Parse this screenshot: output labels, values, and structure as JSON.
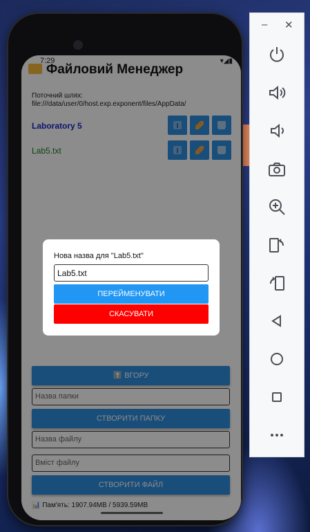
{
  "status_bar": {
    "time": "7:29",
    "right": "▾◢▮"
  },
  "app": {
    "title": "Файловий Менеджер",
    "path": "Поточний шлях: file:///data/user/0/host.exp.exponent/files/AppData/"
  },
  "entries": [
    {
      "name": "Laboratory 5",
      "kind": "folder"
    },
    {
      "name": "Lab5.txt",
      "kind": "file"
    }
  ],
  "buttons": {
    "up": "⬆️ ВГОРУ",
    "create_folder": "СТВОРИТИ ПАПКУ",
    "create_file": "СТВОРИТИ ФАЙЛ"
  },
  "fields": {
    "folder_name_placeholder": "Назва папки",
    "file_name_placeholder": "Назва файлу",
    "file_content_placeholder": "Вміст файлу"
  },
  "memory": "📊 Пам'ять: 1907.94MB / 5939.59MB",
  "dialog": {
    "title": "Нова назва для \"Lab5.txt\"",
    "input_value": "Lab5.txt",
    "rename": "ПЕРЕЙМЕНУВАТИ",
    "cancel": "СКАСУВАТИ"
  },
  "emulator": {
    "minimize": "–",
    "close": "✕",
    "tools": [
      "power-icon",
      "volume-up-icon",
      "volume-down-icon",
      "camera-icon",
      "zoom-in-icon",
      "rotate-left-icon",
      "rotate-right-icon",
      "back-icon",
      "home-icon",
      "overview-icon",
      "more-icon"
    ]
  },
  "colors": {
    "accent": "#2e8ddf",
    "rename": "#2196f3",
    "cancel": "#ff0000",
    "folder_text": "#1a27c8",
    "file_text": "#1b7a1b"
  }
}
